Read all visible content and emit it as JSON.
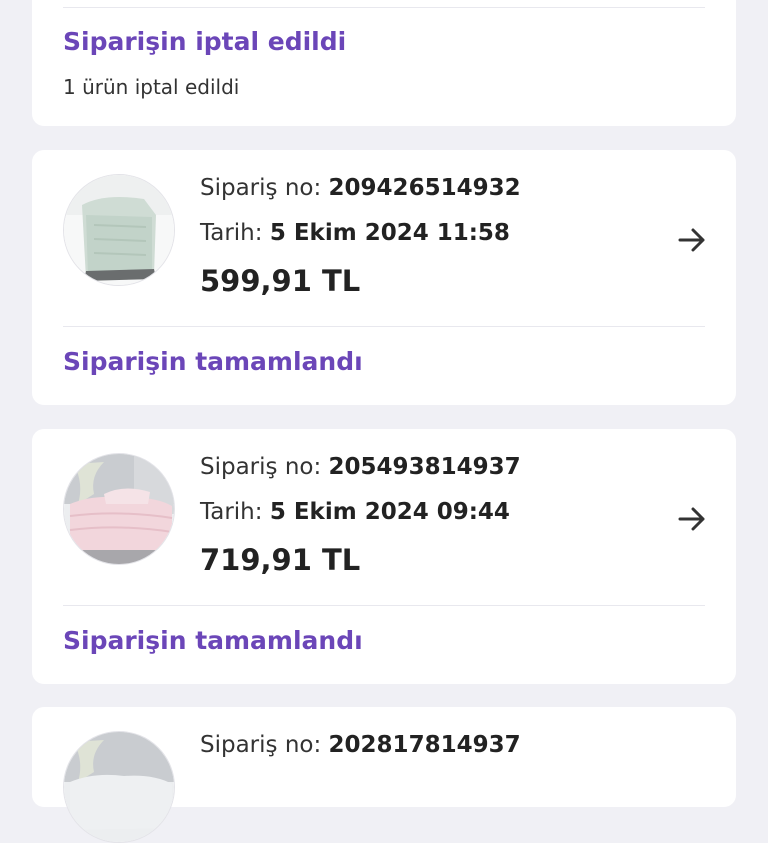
{
  "colors": {
    "background": "#f0f0f5",
    "card": "#ffffff",
    "status_purple": "#6b46b8",
    "text_dark": "#222222"
  },
  "cancelled_card": {
    "status": "Siparişin iptal edildi",
    "detail": "1 ürün iptal edildi"
  },
  "orders": [
    {
      "order_no_label": "Sipariş no:",
      "order_no": "209426514932",
      "date_label": "Tarih:",
      "date": "5 Ekim 2024 11:58",
      "price": "599,91 TL",
      "status": "Siparişin tamamlandı",
      "thumbnail": "mint-duvet-image",
      "arrow_icon": "arrow-right-icon"
    },
    {
      "order_no_label": "Sipariş no:",
      "order_no": "205493814937",
      "date_label": "Tarih:",
      "date": "5 Ekim 2024 09:44",
      "price": "719,91 TL",
      "status": "Siparişin tamamlandı",
      "thumbnail": "pink-duvet-image",
      "arrow_icon": "arrow-right-icon"
    },
    {
      "order_no_label": "Sipariş no:",
      "order_no": "202817814937",
      "thumbnail": "duvet-image"
    }
  ]
}
